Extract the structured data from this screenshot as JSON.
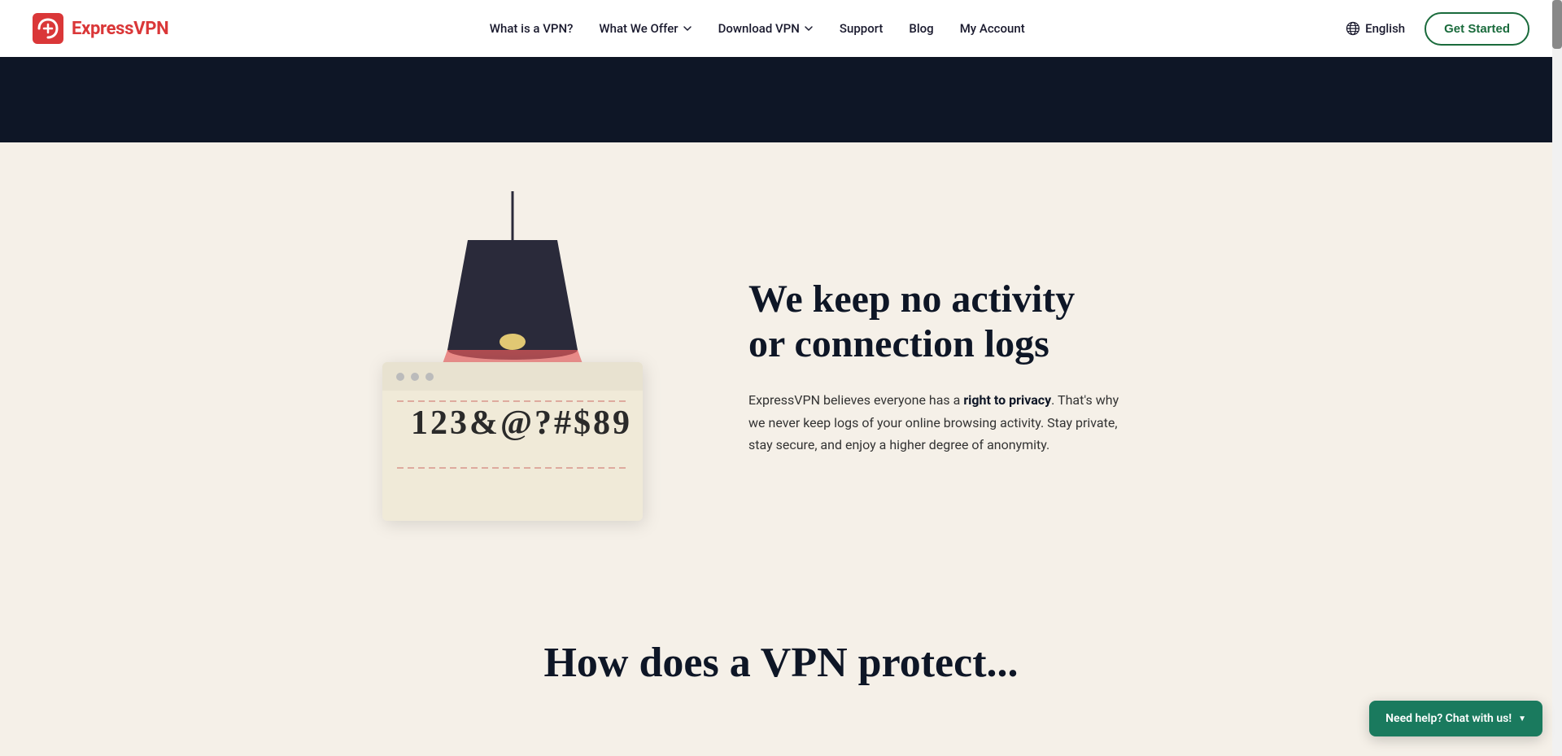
{
  "header": {
    "logo_text": "ExpressVPN",
    "nav_items": [
      {
        "label": "What is a VPN?",
        "has_dropdown": false
      },
      {
        "label": "What We Offer",
        "has_dropdown": true
      },
      {
        "label": "Download VPN",
        "has_dropdown": true
      },
      {
        "label": "Support",
        "has_dropdown": false
      },
      {
        "label": "Blog",
        "has_dropdown": false
      },
      {
        "label": "My Account",
        "has_dropdown": false
      }
    ],
    "language": "English",
    "cta_button": "Get Started"
  },
  "main": {
    "section_title_line1": "We keep no activity",
    "section_title_line2": "or connection logs",
    "description_prefix": "ExpressVPN believes everyone has a ",
    "description_bold": "right to privacy",
    "description_suffix": ". That's why we never keep logs of your online browsing activity. Stay private, stay secure, and enjoy a higher degree of anonymity.",
    "illustration_text": "123&@?#$89"
  },
  "bottom": {
    "title_partial": "How does a VPN protect..."
  },
  "chat": {
    "label": "Need help? Chat with us!",
    "chevron": "▼"
  },
  "colors": {
    "logo_red": "#da3738",
    "nav_dark": "#0e1626",
    "cta_green": "#1a6b3c",
    "chat_green": "#1a7a5e",
    "bg_cream": "#f5f0e8",
    "dark_banner": "#0e1626"
  }
}
